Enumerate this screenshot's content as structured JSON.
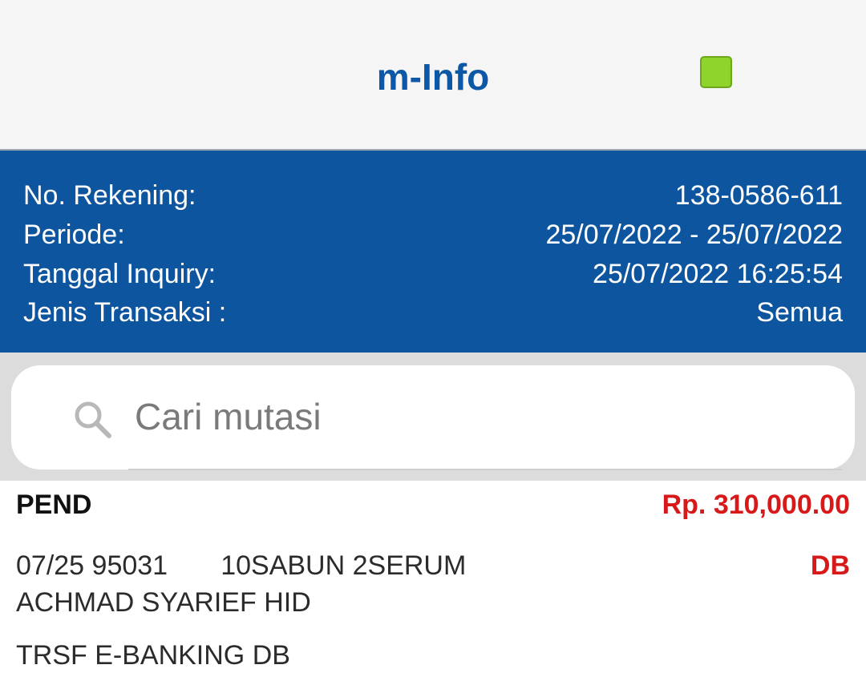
{
  "header": {
    "title": "m-Info",
    "status_color": "#8fd42a"
  },
  "info": {
    "rows": [
      {
        "label": "No. Rekening:",
        "value": "138-0586-611"
      },
      {
        "label": "Periode:",
        "value": "25/07/2022 - 25/07/2022"
      },
      {
        "label": "Tanggal Inquiry:",
        "value": "25/07/2022 16:25:54"
      },
      {
        "label": "Jenis Transaksi :",
        "value": "Semua"
      }
    ],
    "background": "#0e559f"
  },
  "search": {
    "placeholder": "Cari mutasi",
    "icon": "search-icon"
  },
  "transactions": [
    {
      "status": "PEND",
      "amount": "Rp. 310,000.00",
      "type": "DB",
      "line1": "07/25 95031       10SABUN 2SERUM",
      "line2": "ACHMAD SYARIEF HID",
      "line3": "TRSF E-BANKING DB"
    }
  ],
  "colors": {
    "accent": "#0d58a6",
    "debit": "#d8191a"
  }
}
